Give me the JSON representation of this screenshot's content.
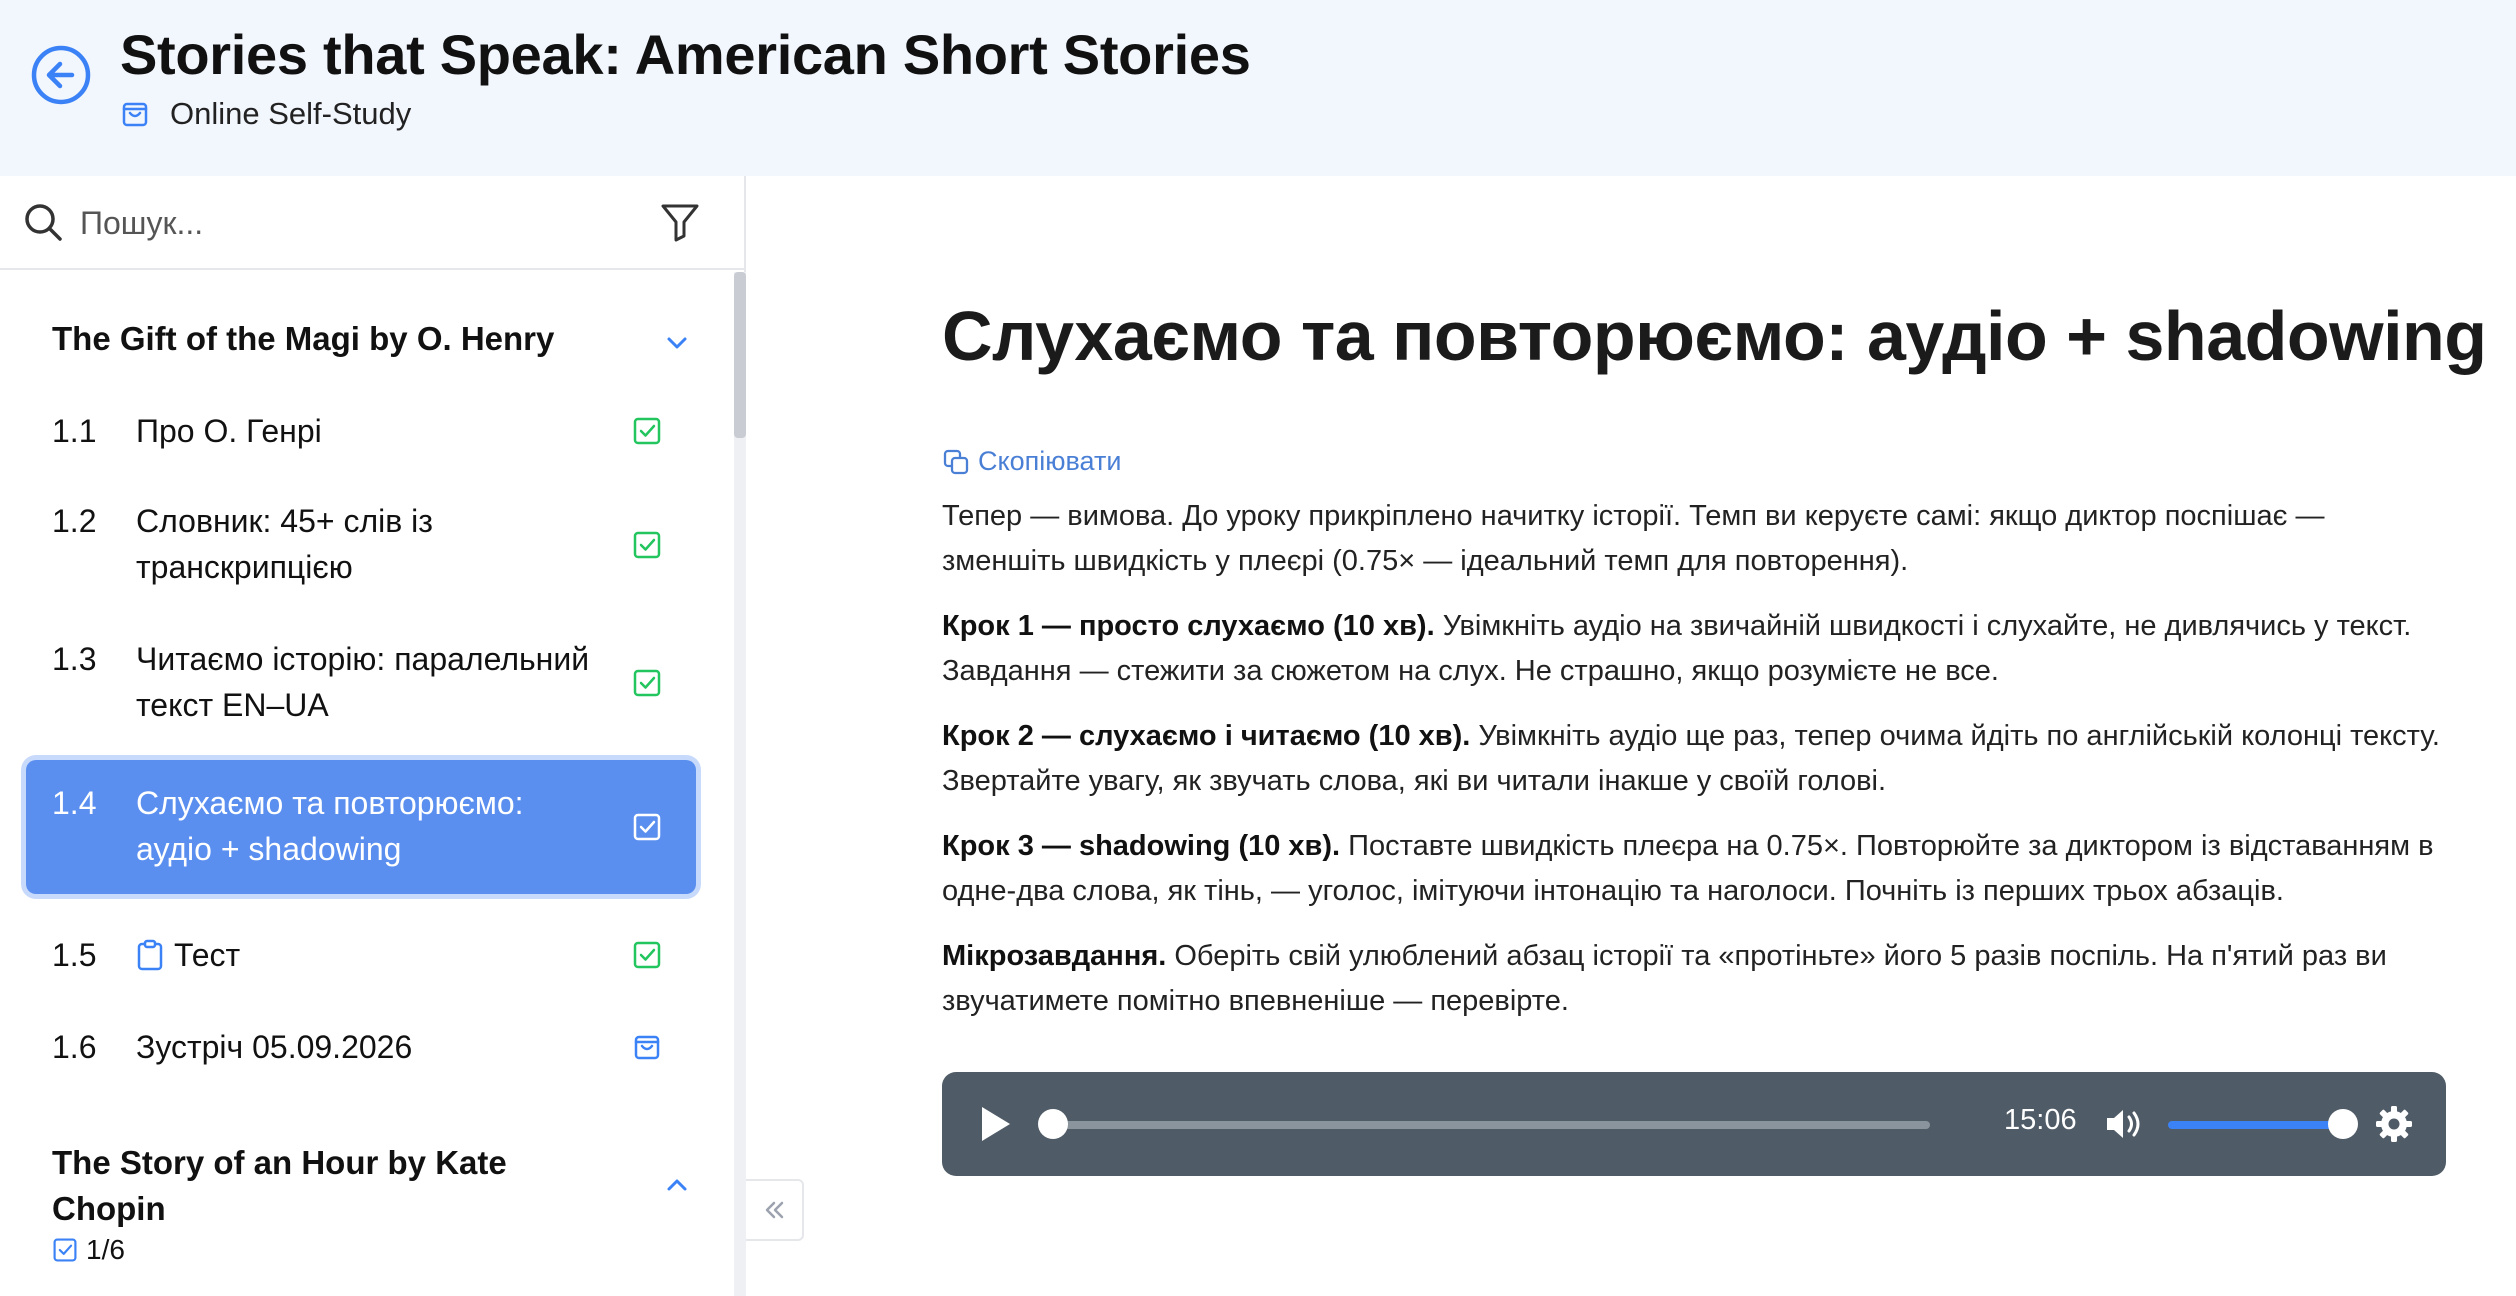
{
  "header": {
    "title": "Stories that Speak: American Short Stories",
    "subtitle": "Online Self-Study"
  },
  "search": {
    "placeholder": "Пошук..."
  },
  "modules": [
    {
      "title": "The Gift of the Magi by O. Henry",
      "expanded": true,
      "lessons": [
        {
          "num": "1.1",
          "title": "Про О. Генрі",
          "status": "completed"
        },
        {
          "num": "1.2",
          "title": "Словник: 45+ слів із транскрипцією",
          "status": "completed"
        },
        {
          "num": "1.3",
          "title": "Читаємо історію: паралельний текст EN–UA",
          "status": "completed"
        },
        {
          "num": "1.4",
          "title": "Слухаємо та повторюємо: аудіо + shadowing",
          "status": "completed",
          "active": true
        },
        {
          "num": "1.5",
          "title": "Тест",
          "status": "completed",
          "icon": "clipboard-icon"
        },
        {
          "num": "1.6",
          "title": "Зустріч 05.09.2026",
          "status": "scheduled"
        }
      ]
    },
    {
      "title": "The Story of an Hour by Kate Chopin",
      "expanded": false,
      "progress": "1/6"
    }
  ],
  "lesson": {
    "heading": "Слухаємо та повторюємо: аудіо + shadowing",
    "copy_label": "Скопіювати",
    "intro": "Тепер — вимова. До уроку прикріплено начитку історії. Темп ви керуєте самі: якщо диктор поспішає — зменшіть швидкість у плеєрі (0.75× — ідеальний темп для повторення).",
    "step1_label": "Крок 1 — просто слухаємо (10 хв).",
    "step1_text": " Увімкніть аудіо на звичайній швидкості і слухайте, не дивлячись у текст. Завдання — стежити за сюжетом на слух. Не страшно, якщо розумієте не все.",
    "step2_label": "Крок 2 — слухаємо і читаємо (10 хв).",
    "step2_text": " Увімкніть аудіо ще раз, тепер очима йдіть по англійській колонці тексту. Звертайте увагу, як звучать слова, які ви читали інакше у своїй голові.",
    "step3_label": "Крок 3 — shadowing (10 хв).",
    "step3_text": " Поставте швидкість плеєра на 0.75×. Повторюйте за диктором із відставанням в одне-два слова, як тінь, — уголос, імітуючи інтонацію та наголоси. Почніть із перших трьох абзаців.",
    "micro_label": "Мікрозавдання.",
    "micro_text": " Оберіть свій улюблений абзац історії та «протіньте» його 5 разів поспіль. На п'ятий раз ви звучатимете помітно впевненіше — перевірте."
  },
  "player": {
    "time": "15:06",
    "progress": 0.0,
    "volume": 1.0
  },
  "colors": {
    "header_bg": "#f2f6fd",
    "accent": "#5a8ff0",
    "check_green": "#22c55e",
    "link_blue": "#4a7fd6",
    "player_bg": "#4f5b66"
  }
}
